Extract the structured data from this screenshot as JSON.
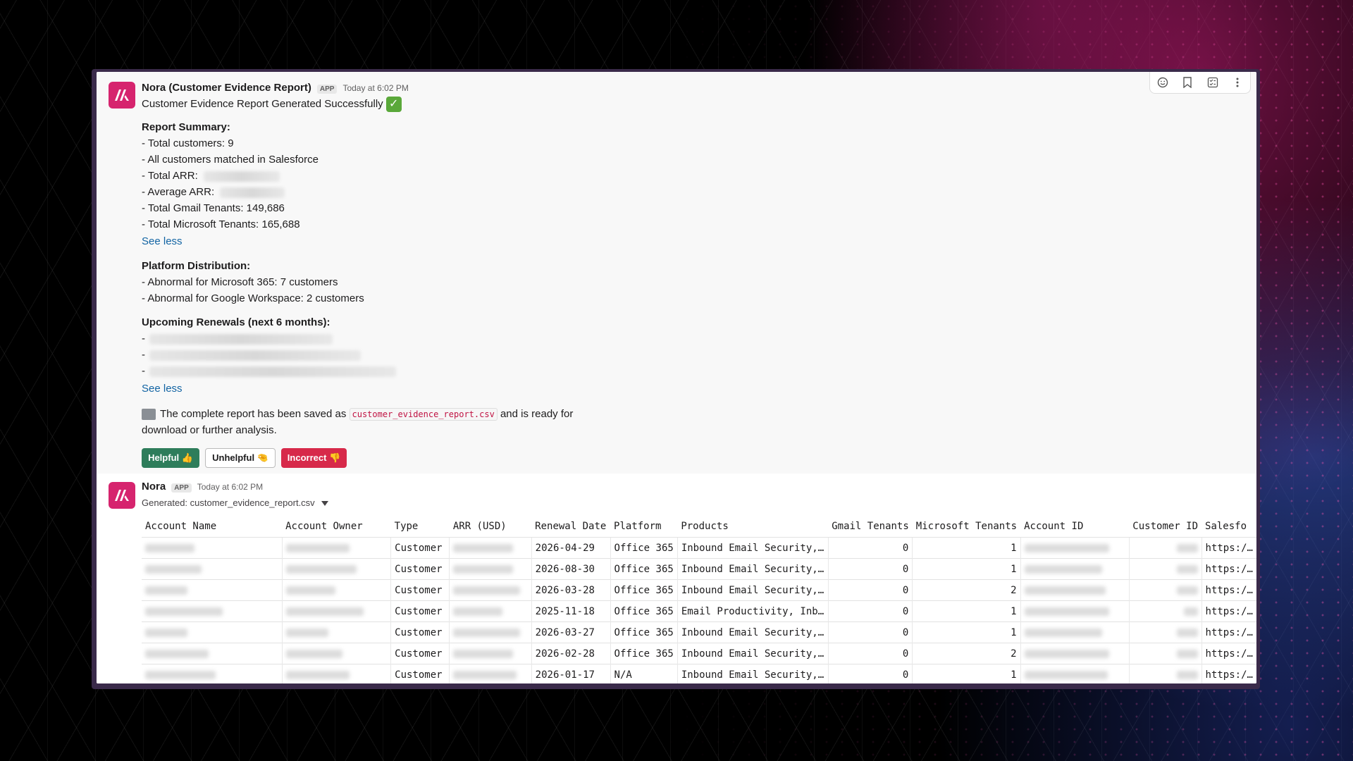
{
  "message1": {
    "sender": "Nora (Customer Evidence Report)",
    "badge": "APP",
    "time": "Today at 6:02 PM",
    "headline": "Customer Evidence Report Generated Successfully",
    "summary_heading": "Report Summary:",
    "summary_items": [
      "- Total customers: 9",
      "- All customers matched in Salesforce",
      "- Total ARR:",
      "- Average ARR:",
      "- Total Gmail Tenants: 149,686",
      "- Total Microsoft Tenants: 165,688"
    ],
    "see_less_1": "See less",
    "platform_heading": "Platform Distribution:",
    "platform_items": [
      "- Abnormal for Microsoft 365: 7 customers",
      "- Abnormal for Google Workspace: 2 customers"
    ],
    "renewals_heading": "Upcoming Renewals (next 6 months):",
    "renewal_dash": "-",
    "see_less_2": "See less",
    "report_saved_pre": "The complete report has been saved as",
    "report_filename": "customer_evidence_report.csv",
    "report_saved_post": "and is ready for",
    "report_saved_line2": "download or further analysis.",
    "buttons": {
      "helpful": "Helpful 👍",
      "unhelpful": "Unhelpful 🤏",
      "incorrect": "Incorrect 👎"
    }
  },
  "message2": {
    "sender": "Nora",
    "badge": "APP",
    "time": "Today at 6:02 PM",
    "file_label": "Generated: customer_evidence_report.csv",
    "table": {
      "columns": [
        "Account Name",
        "Account Owner",
        "Type",
        "ARR (USD)",
        "Renewal Date",
        "Platform",
        "Products",
        "Gmail Tenants",
        "Microsoft Tenants",
        "Account ID",
        "Customer ID",
        "Salesfo"
      ],
      "rows": [
        [
          "",
          "",
          "Customer",
          "",
          "2026-04-29",
          "Office 365",
          "Inbound Email Security,…",
          "0",
          "1",
          "",
          "",
          "https:/…"
        ],
        [
          "",
          "",
          "Customer",
          "",
          "2026-08-30",
          "Office 365",
          "Inbound Email Security,…",
          "0",
          "1",
          "",
          "",
          "https:/…"
        ],
        [
          "",
          "",
          "Customer",
          "",
          "2026-03-28",
          "Office 365",
          "Inbound Email Security,…",
          "0",
          "2",
          "",
          "",
          "https:/…"
        ],
        [
          "",
          "",
          "Customer",
          "",
          "2025-11-18",
          "Office 365",
          "Email Productivity, Inb…",
          "0",
          "1",
          "",
          "",
          "https:/…"
        ],
        [
          "",
          "",
          "Customer",
          "",
          "2026-03-27",
          "Office 365",
          "Inbound Email Security,…",
          "0",
          "1",
          "",
          "",
          "https:/…"
        ],
        [
          "",
          "",
          "Customer",
          "",
          "2026-02-28",
          "Office 365",
          "Inbound Email Security,…",
          "0",
          "2",
          "",
          "",
          "https:/…"
        ],
        [
          "",
          "",
          "Customer",
          "",
          "2026-01-17",
          "N/A",
          "Inbound Email Security,…",
          "0",
          "1",
          "",
          "",
          "https:/…"
        ]
      ]
    }
  },
  "colors": {
    "brand": "#d6246e",
    "link": "#1264a3",
    "helpful": "#2e7d5b",
    "incorrect": "#d7294a"
  }
}
